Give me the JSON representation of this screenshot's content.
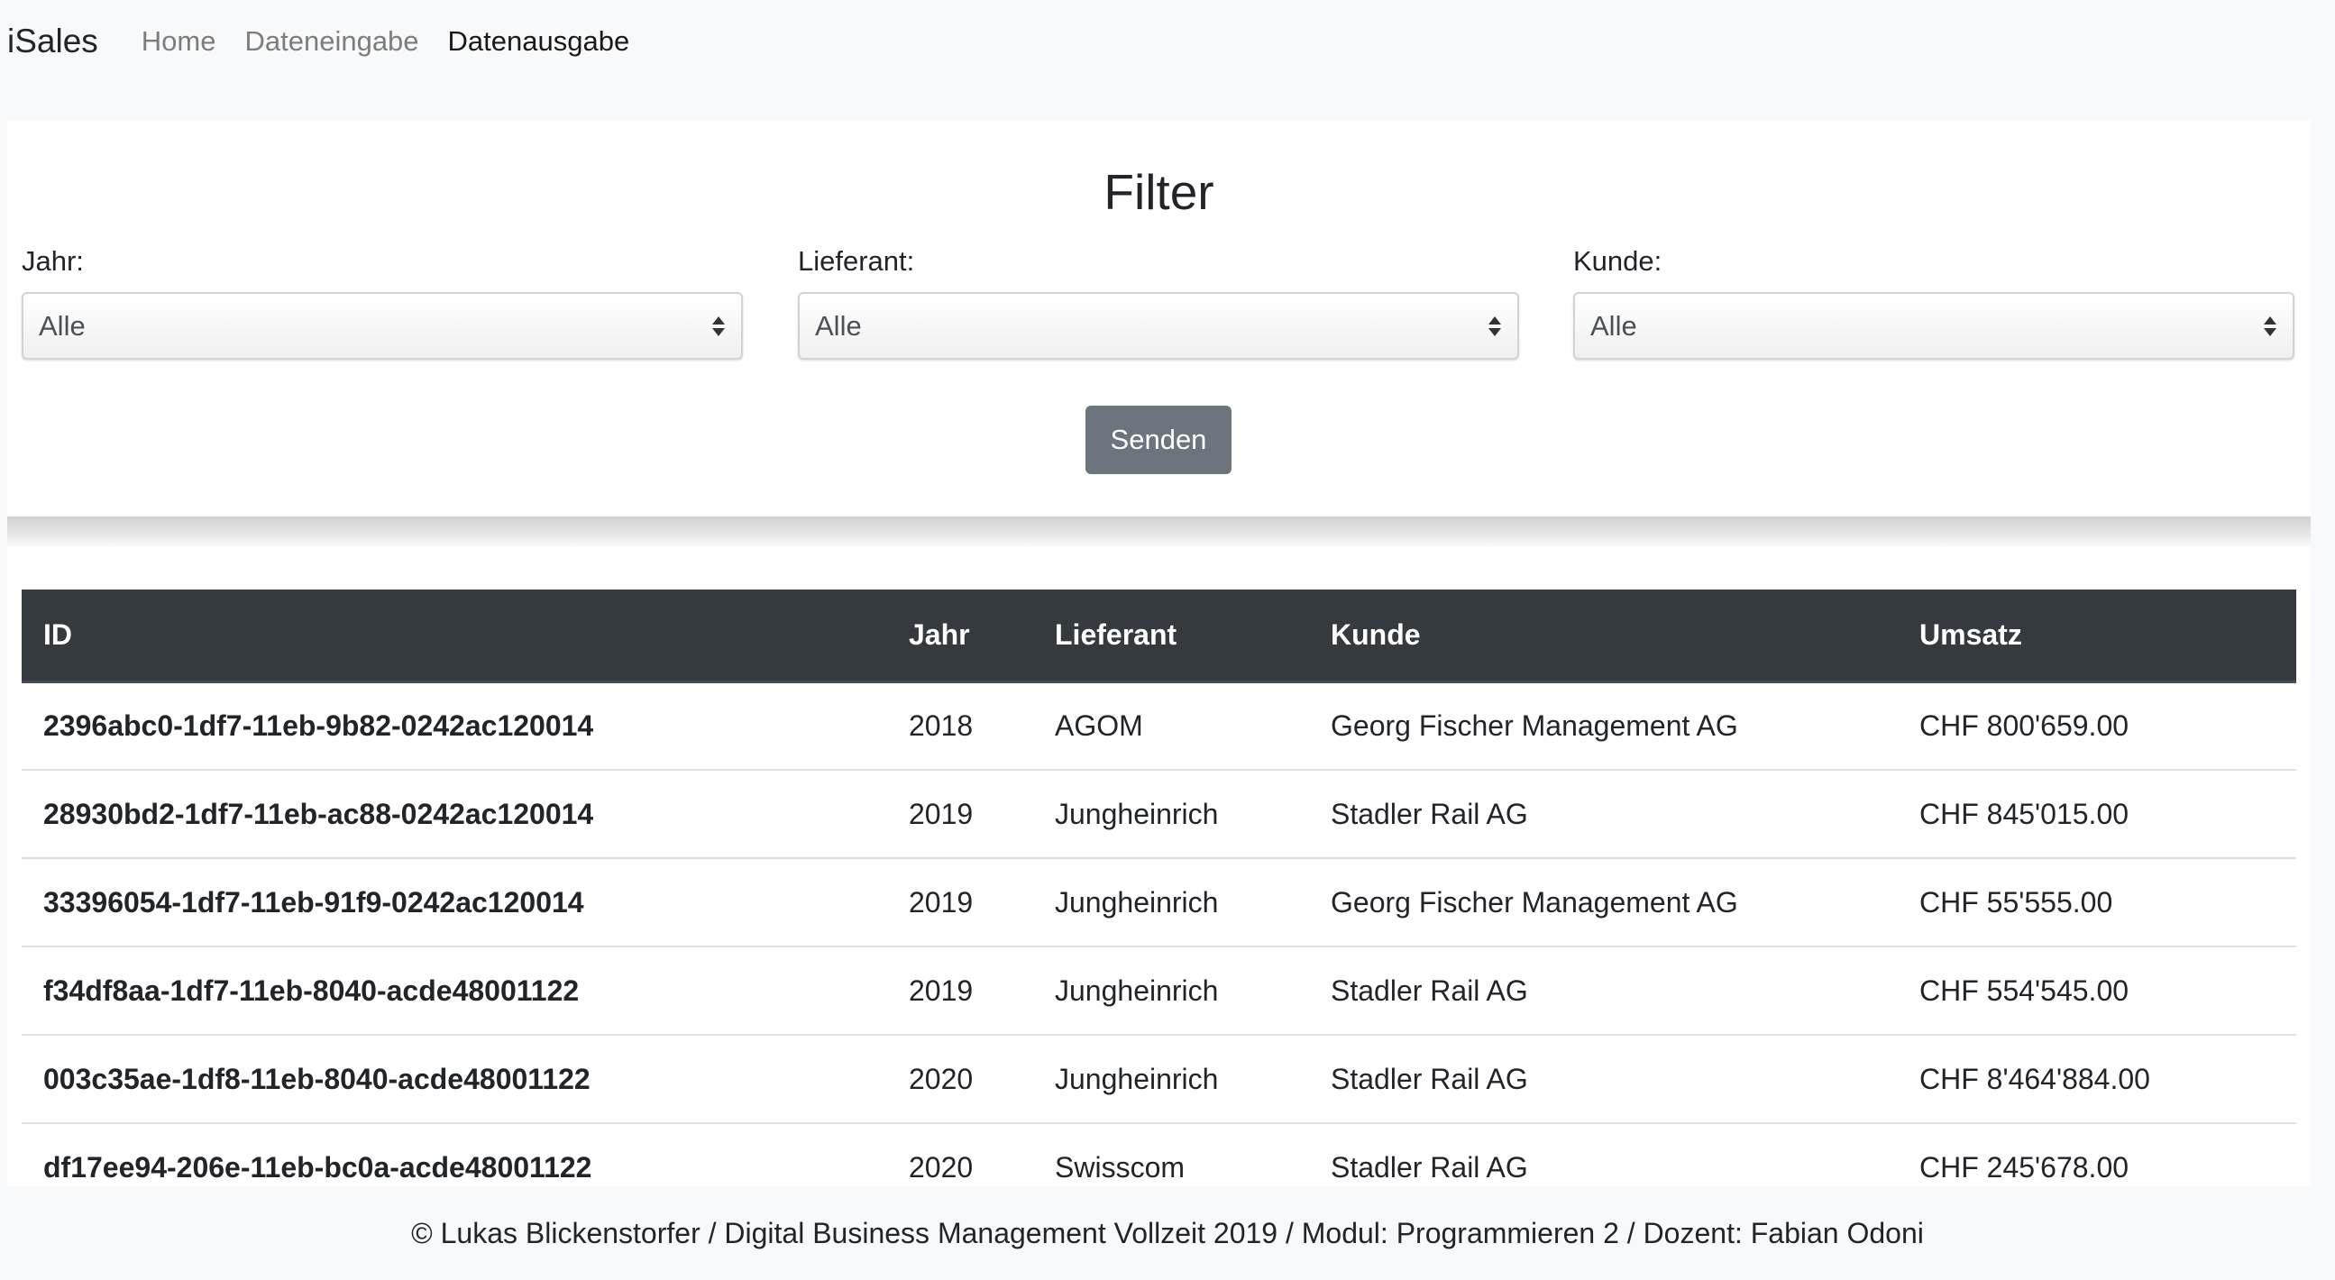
{
  "navbar": {
    "brand": "iSales",
    "links": [
      {
        "label": "Home"
      },
      {
        "label": "Dateneingabe"
      },
      {
        "label": "Datenausgabe"
      }
    ]
  },
  "filter": {
    "title": "Filter",
    "year": {
      "label": "Jahr:",
      "value": "Alle"
    },
    "supplier": {
      "label": "Lieferant:",
      "value": "Alle"
    },
    "customer": {
      "label": "Kunde:",
      "value": "Alle"
    },
    "submit_label": "Senden"
  },
  "table": {
    "headers": [
      "ID",
      "Jahr",
      "Lieferant",
      "Kunde",
      "Umsatz"
    ],
    "rows": [
      {
        "id": "2396abc0-1df7-11eb-9b82-0242ac120014",
        "year": "2018",
        "supplier": "AGOM",
        "customer": "Georg Fischer Management AG",
        "revenue": "CHF 800'659.00"
      },
      {
        "id": "28930bd2-1df7-11eb-ac88-0242ac120014",
        "year": "2019",
        "supplier": "Jungheinrich",
        "customer": "Stadler Rail AG",
        "revenue": "CHF 845'015.00"
      },
      {
        "id": "33396054-1df7-11eb-91f9-0242ac120014",
        "year": "2019",
        "supplier": "Jungheinrich",
        "customer": "Georg Fischer Management AG",
        "revenue": "CHF 55'555.00"
      },
      {
        "id": "f34df8aa-1df7-11eb-8040-acde48001122",
        "year": "2019",
        "supplier": "Jungheinrich",
        "customer": "Stadler Rail AG",
        "revenue": "CHF 554'545.00"
      },
      {
        "id": "003c35ae-1df8-11eb-8040-acde48001122",
        "year": "2020",
        "supplier": "Jungheinrich",
        "customer": "Stadler Rail AG",
        "revenue": "CHF 8'464'884.00"
      },
      {
        "id": "df17ee94-206e-11eb-bc0a-acde48001122",
        "year": "2020",
        "supplier": "Swisscom",
        "customer": "Stadler Rail AG",
        "revenue": "CHF 245'678.00"
      }
    ]
  },
  "footer": {
    "text": "© Lukas Blickenstorfer / Digital Business Management Vollzeit 2019 / Modul: Programmieren 2 / Dozent: Fabian Odoni"
  }
}
